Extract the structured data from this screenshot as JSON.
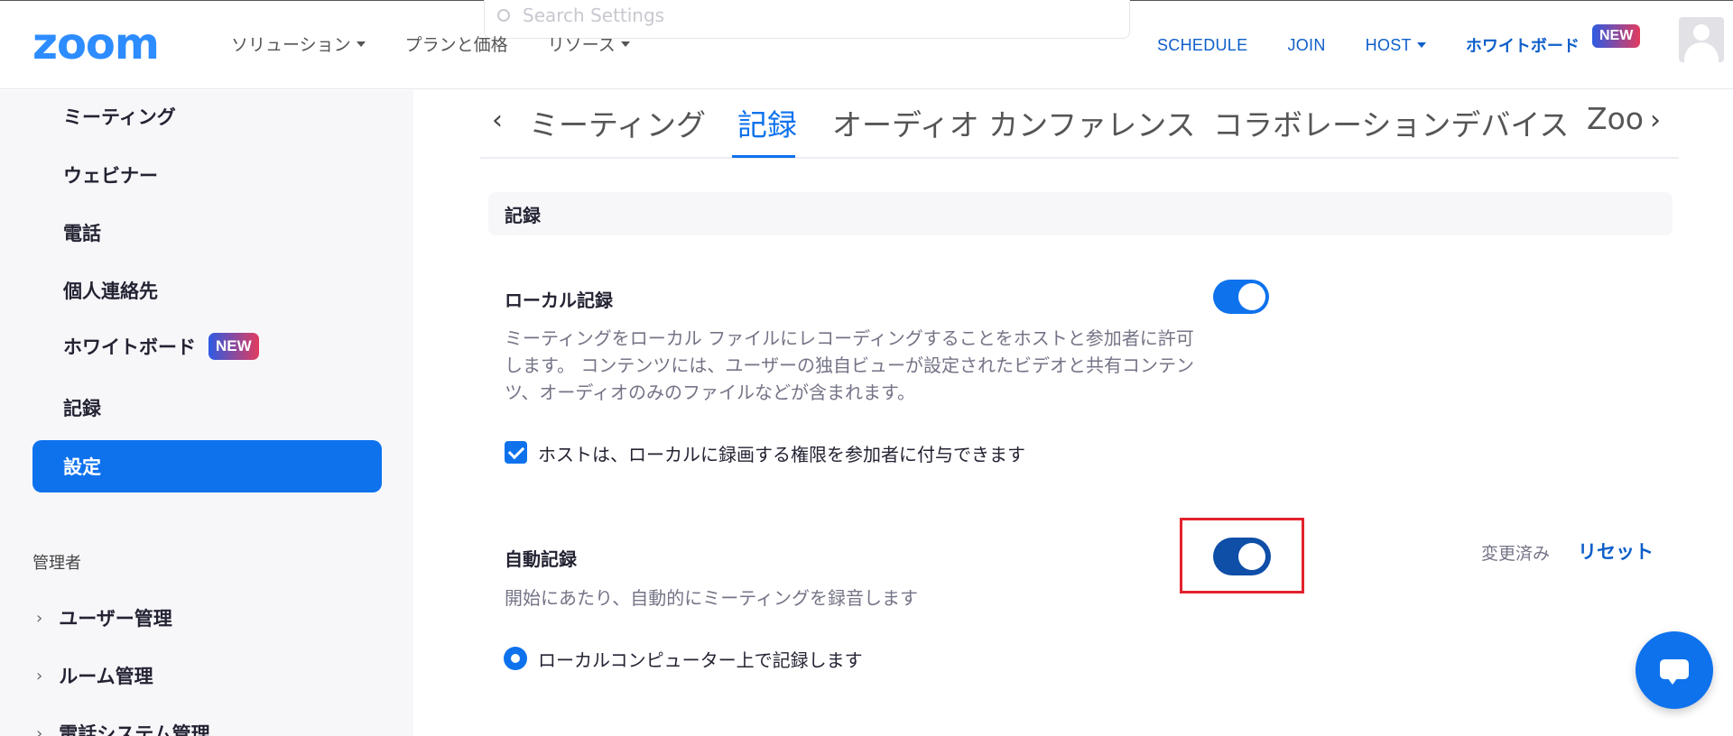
{
  "header": {
    "logo": "zoom",
    "nav_left": [
      {
        "label": "ソリューション",
        "dropdown": true
      },
      {
        "label": "プランと価格",
        "dropdown": false
      },
      {
        "label": "リソース",
        "dropdown": true
      }
    ],
    "search_placeholder": "Search Settings",
    "nav_right": {
      "schedule": "SCHEDULE",
      "join": "JOIN",
      "host": "HOST",
      "whiteboard": "ホワイトボード",
      "new_badge": "NEW"
    }
  },
  "sidebar": {
    "items": [
      {
        "label": "ミーティング"
      },
      {
        "label": "ウェビナー"
      },
      {
        "label": "電話"
      },
      {
        "label": "個人連絡先"
      },
      {
        "label": "ホワイトボード",
        "badge": "NEW"
      },
      {
        "label": "記録"
      }
    ],
    "active": "設定",
    "admin_section": "管理者",
    "admin_groups": [
      "ユーザー管理",
      "ルーム管理",
      "電話システム管理"
    ]
  },
  "tabs": {
    "items": [
      "ミーティング",
      "記録",
      "オーディオ カンファレンス",
      "コラボレーションデバイス",
      "Zoo"
    ],
    "active_index": 1
  },
  "section": {
    "title": "記録"
  },
  "settings": {
    "local_recording": {
      "title": "ローカル記録",
      "description": "ミーティングをローカル ファイルにレコーディングすることをホストと参加者に許可します。 コンテンツには、ユーザーの独自ビューが設定されたビデオと共有コンテンツ、オーディオのみのファイルなどが含まれます。",
      "enabled": true,
      "option_label": "ホストは、ローカルに録画する権限を参加者に付与できます",
      "option_checked": true
    },
    "auto_recording": {
      "title": "自動記録",
      "description": "開始にあたり、自動的にミーティングを録音します",
      "enabled": true,
      "changed_label": "変更済み",
      "reset_label": "リセット",
      "radio_label": "ローカルコンピューター上で記録します",
      "radio_selected": true
    }
  },
  "colors": {
    "accent": "#0e72ed",
    "brand": "#2d8cff",
    "highlight": "#e3222c"
  }
}
